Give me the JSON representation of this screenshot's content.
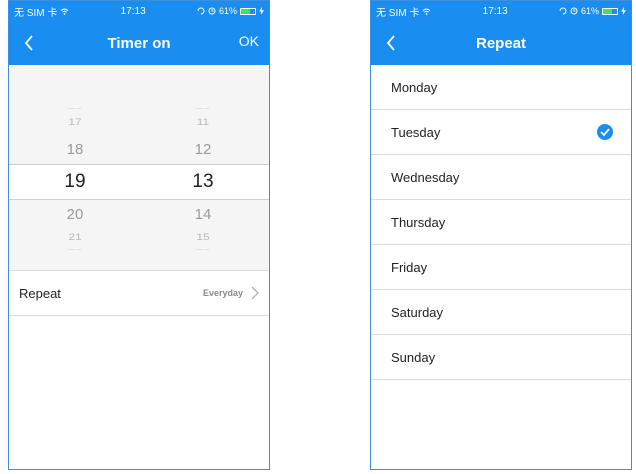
{
  "status_bar": {
    "carrier": "无 SIM 卡",
    "wifi_icon": "wifi-icon",
    "time": "17:13",
    "battery_percent": "61%",
    "battery_level": 0.61,
    "status_icons": [
      "orientation-lock-icon",
      "alarm-icon",
      "battery-icon",
      "charging-icon"
    ]
  },
  "timer_screen": {
    "title": "Timer on",
    "back_icon": "chevron-left-icon",
    "ok_label": "OK",
    "hours": {
      "prev2": "17",
      "prev1": "18",
      "selected": "19",
      "next1": "20",
      "next2": "21"
    },
    "minutes": {
      "prev2": "11",
      "prev1": "12",
      "selected": "13",
      "next1": "14",
      "next2": "15"
    },
    "repeat_label": "Repeat",
    "repeat_value": "Everyday",
    "chevron_icon": "chevron-right-icon"
  },
  "repeat_screen": {
    "title": "Repeat",
    "back_icon": "chevron-left-icon",
    "days": [
      "Monday",
      "Tuesday",
      "Wednesday",
      "Thursday",
      "Friday",
      "Saturday",
      "Sunday"
    ],
    "selected_day": "Tuesday",
    "check_icon": "checkmark-icon"
  },
  "colors": {
    "accent": "#1a8df0",
    "battery": "#3ce36a",
    "divider": "#dcdcdc"
  }
}
